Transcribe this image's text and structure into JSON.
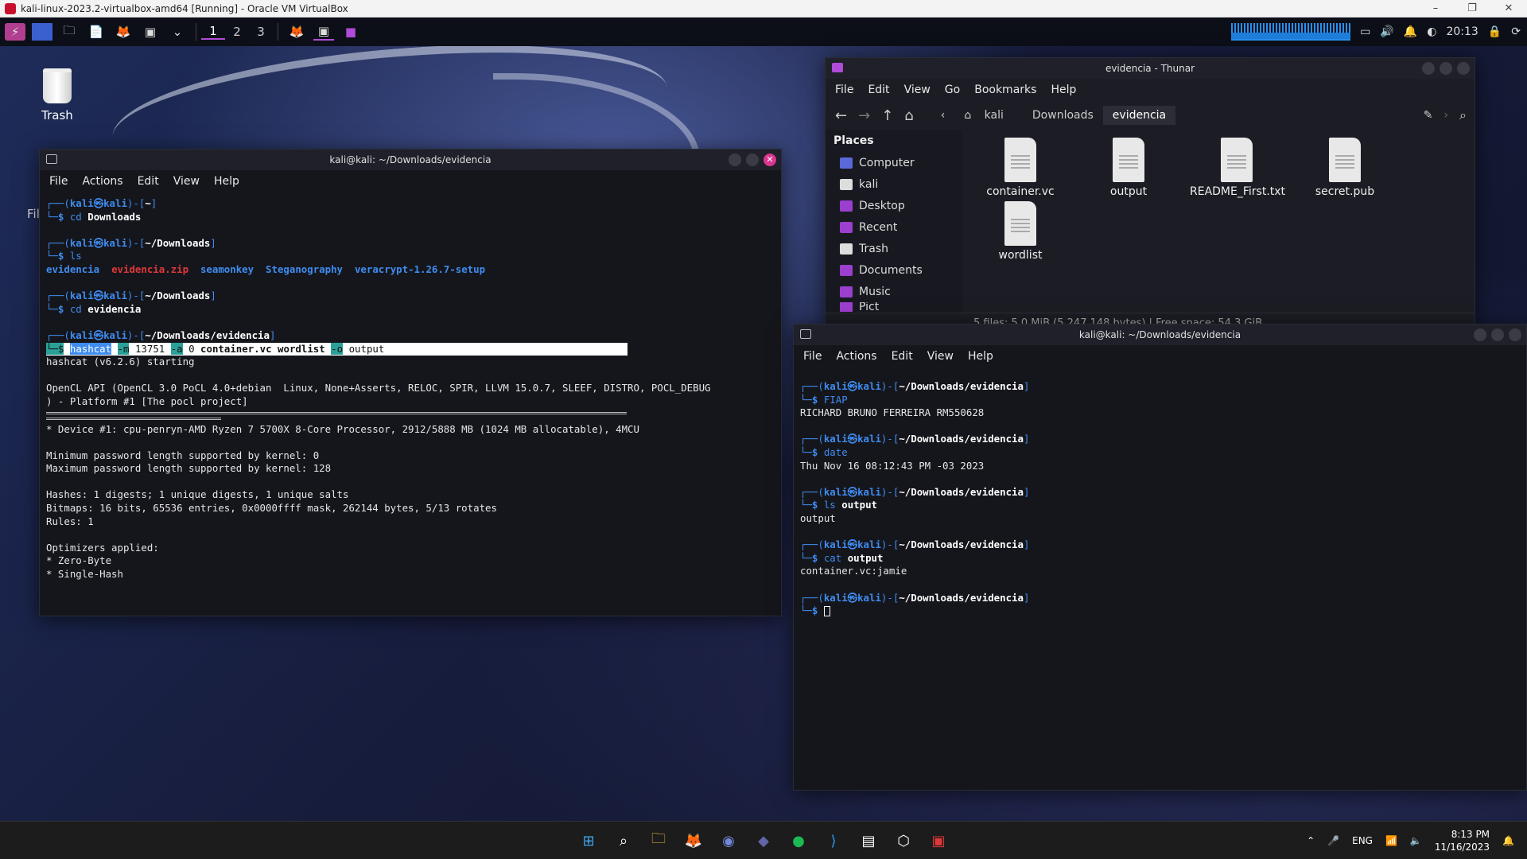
{
  "vbox": {
    "title": "kali-linux-2023.2-virtualbox-amd64 [Running] - Oracle VM VirtualBox",
    "minimize": "–",
    "restore": "❐",
    "close": "✕"
  },
  "panel": {
    "workspaces": [
      "1",
      "2",
      "3"
    ],
    "clock": "20:13"
  },
  "desktop": {
    "trash_label": "Trash",
    "partial_label": "Fil"
  },
  "term1": {
    "title": "kali@kali: ~/Downloads/evidencia",
    "menu": [
      "File",
      "Actions",
      "Edit",
      "View",
      "Help"
    ],
    "prompt_user": "kali",
    "dirs": [
      "~",
      "~/Downloads",
      "~/Downloads",
      "~/Downloads/evidencia"
    ],
    "cmd1": "cd",
    "arg1": "Downloads",
    "cmd2": "ls",
    "ls_items": [
      "evidencia",
      "evidencia.zip",
      "seamonkey",
      "Steganography",
      "veracrypt-1.26.7-setup"
    ],
    "cmd3": "cd",
    "arg3": "evidencia",
    "hashcat_cmd": "hashcat",
    "hashcat_m": "-m",
    "hashcat_mode": "13751",
    "hashcat_a": "-a",
    "hashcat_attack": "0",
    "hashcat_files": "container.vc wordlist",
    "hashcat_o": "-o",
    "hashcat_out": "output",
    "out": [
      "hashcat (v6.2.6) starting",
      "",
      "OpenCL API (OpenCL 3.0 PoCL 4.0+debian  Linux, None+Asserts, RELOC, SPIR, LLVM 15.0.7, SLEEF, DISTRO, POCL_DEBUG",
      ") - Platform #1 [The pocl project]"
    ],
    "out2": [
      "* Device #1: cpu-penryn-AMD Ryzen 7 5700X 8-Core Processor, 2912/5888 MB (1024 MB allocatable), 4MCU",
      "",
      "Minimum password length supported by kernel: 0",
      "Maximum password length supported by kernel: 128",
      "",
      "Hashes: 1 digests; 1 unique digests, 1 unique salts",
      "Bitmaps: 16 bits, 65536 entries, 0x0000ffff mask, 262144 bytes, 5/13 rotates",
      "Rules: 1",
      "",
      "Optimizers applied:",
      "* Zero-Byte",
      "* Single-Hash"
    ]
  },
  "thunar": {
    "title": "evidencia - Thunar",
    "menu": [
      "File",
      "Edit",
      "View",
      "Go",
      "Bookmarks",
      "Help"
    ],
    "crumbs": [
      "kali",
      "Downloads",
      "evidencia"
    ],
    "places_header": "Places",
    "places": [
      "Computer",
      "kali",
      "Desktop",
      "Recent",
      "Trash",
      "Documents",
      "Music",
      "Pict"
    ],
    "files": [
      "container.vc",
      "output",
      "README_First.txt",
      "secret.pub",
      "wordlist"
    ],
    "status": "5 files: 5.0 MiB (5,247,148 bytes)  |  Free space: 54.3 GiB"
  },
  "term2": {
    "title": "kali@kali: ~/Downloads/evidencia",
    "menu": [
      "File",
      "Actions",
      "Edit",
      "View",
      "Help"
    ],
    "dir": "~/Downloads/evidencia",
    "blocks": [
      {
        "cmd": "FIAP",
        "arg": "",
        "out": "RICHARD BRUNO FERREIRA RM550628"
      },
      {
        "cmd": "date",
        "arg": "",
        "out": "Thu Nov 16 08:12:43 PM -03 2023"
      },
      {
        "cmd": "ls",
        "arg": "output",
        "out": "output"
      },
      {
        "cmd": "cat",
        "arg": "output",
        "out": "container.vc:jamie"
      }
    ]
  },
  "taskbar": {
    "lang": "ENG",
    "time": "8:13 PM",
    "date": "11/16/2023"
  }
}
